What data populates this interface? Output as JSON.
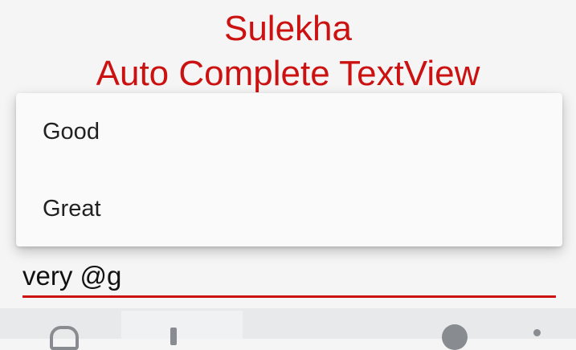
{
  "title": {
    "line1": "Sulekha",
    "line2": "Auto Complete TextView"
  },
  "dropdown": {
    "items": [
      {
        "label": "Good"
      },
      {
        "label": "Great"
      }
    ]
  },
  "input": {
    "value": "very @g"
  },
  "colors": {
    "accent": "#cc1111",
    "background": "#f5f5f5",
    "dropdown_bg": "#fafafa",
    "keyboard_bar": "#e7e9ea"
  },
  "keyboard": {
    "icons": [
      "clipboard-icon",
      "cursor-icon",
      "settings-icon",
      "more-icon"
    ]
  }
}
